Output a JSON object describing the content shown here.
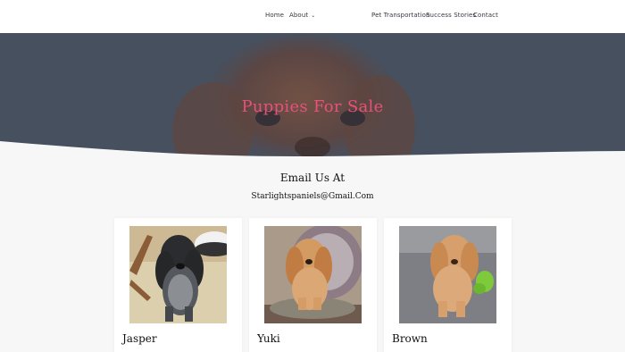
{
  "nav": {
    "home": "Home",
    "about": "About",
    "pet_transportation": "Pet Transportation",
    "success_stories": "Success Stories",
    "contact": "Contact"
  },
  "hero": {
    "title": "Puppies For Sale"
  },
  "email": {
    "heading": "Email Us At",
    "address": "Starlightspaniels@Gmail.Com"
  },
  "puppies": [
    {
      "name": "Jasper"
    },
    {
      "name": "Yuki"
    },
    {
      "name": "Brown"
    }
  ],
  "colors": {
    "title_accent": "#e9507a",
    "hero_overlay": "#47505e",
    "background": "#f7f7f7"
  }
}
